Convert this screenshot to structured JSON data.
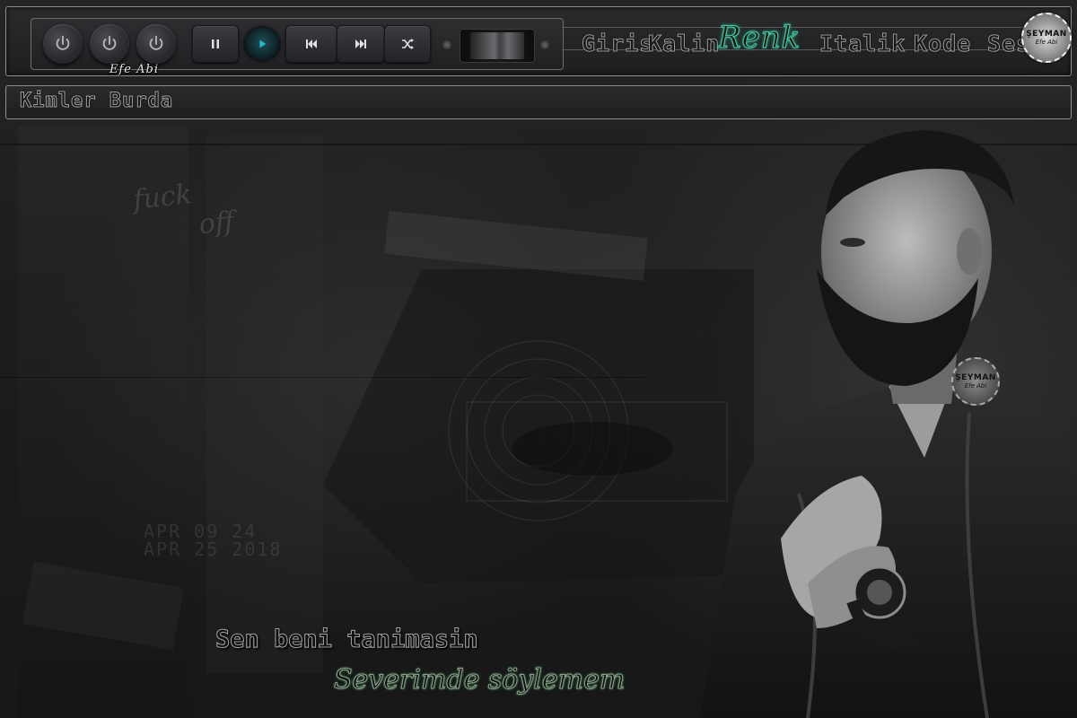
{
  "player": {
    "author_label": "Efe Abi",
    "power_buttons": [
      {
        "icon": "power-icon"
      },
      {
        "icon": "power-icon"
      },
      {
        "icon": "power-icon"
      }
    ],
    "controls": {
      "pause_icon": "pause-icon",
      "play_icon": "play-icon",
      "previous_icon": "skip-previous-icon",
      "next_icon": "skip-next-icon",
      "shuffle_icon": "shuffle-icon"
    },
    "accent_color": "#2bb7c7"
  },
  "menu": {
    "items": [
      {
        "label": "Giris",
        "active": false
      },
      {
        "label": "Kalin",
        "active": false
      },
      {
        "label": "Renk",
        "active": true
      },
      {
        "label": "Italik",
        "active": false
      },
      {
        "label": "Kode",
        "active": false
      },
      {
        "label": "Ses",
        "active": false
      }
    ],
    "active_color": "#4bbf9a"
  },
  "badge": {
    "line1": "ŞEYMAN",
    "line2": "Efe Abi"
  },
  "subbar": {
    "title": "Kimler Burda"
  },
  "background": {
    "scribble_line1": "fuck",
    "scribble_line2": "off",
    "date_line1": "APR 09 24",
    "date_line2": "APR 25 2018"
  },
  "lyrics": {
    "line1": "Sen beni tanimasin",
    "line2": "Severimde söylemem"
  },
  "watermark": {
    "line1": "ŞEYMAN",
    "line2": "Efe Abi"
  }
}
